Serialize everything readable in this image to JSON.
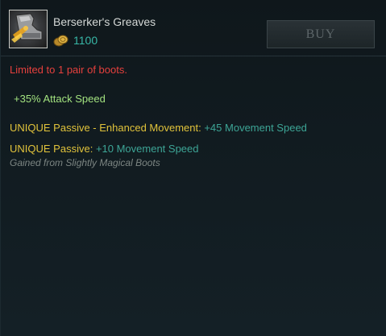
{
  "item": {
    "name": "Berserker's Greaves",
    "icon": "greaves-item-icon",
    "cost": "1100",
    "cost_icon": "gold-coins-icon"
  },
  "actions": {
    "buy_label": "BUY"
  },
  "description": {
    "warning": "Limited to 1 pair of boots.",
    "stat": "+35% Attack Speed",
    "passive_1": {
      "label": "UNIQUE Passive - Enhanced Movement:",
      "value": "+45 Movement Speed"
    },
    "passive_2": {
      "label": "UNIQUE Passive:",
      "value": "+10 Movement Speed",
      "note": "Gained from Slightly Magical Boots"
    }
  },
  "colors": {
    "warning": "#e6403d",
    "stat": "#a2e27f",
    "passive_label": "#e1c33b",
    "passive_value": "#3da596",
    "cost": "#38b7a7"
  }
}
